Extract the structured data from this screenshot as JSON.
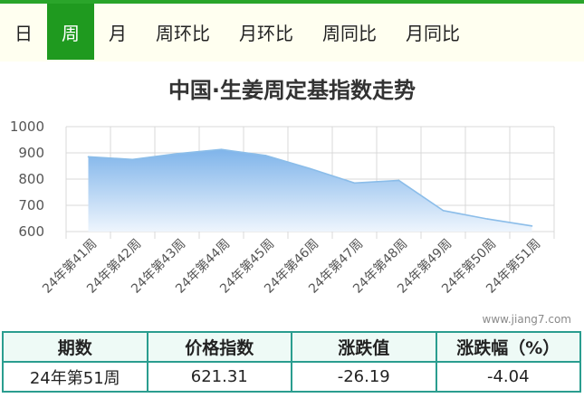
{
  "tabs": [
    {
      "label": "日",
      "active": false
    },
    {
      "label": "周",
      "active": true
    },
    {
      "label": "月",
      "active": false
    },
    {
      "label": "周环比",
      "active": false
    },
    {
      "label": "月环比",
      "active": false
    },
    {
      "label": "周同比",
      "active": false
    },
    {
      "label": "月同比",
      "active": false
    }
  ],
  "watermark": "www.jiang7.com",
  "table": {
    "headers": [
      "期数",
      "价格指数",
      "涨跌值",
      "涨跌幅（%）"
    ],
    "row": [
      "24年第51周",
      "621.31",
      "-26.19",
      "-4.04"
    ]
  },
  "colors": {
    "accent_green": "#1f9a1f",
    "area_top": "#7fb4ea",
    "area_bottom": "#eef5fd",
    "line": "#8bbde9",
    "table_border": "#2a9d8f",
    "table_header_bg": "#eefaf6"
  },
  "chart_data": {
    "type": "area",
    "title": "中国·生姜周定基指数走势",
    "categories": [
      "24年第41周",
      "24年第42周",
      "24年第43周",
      "24年第44周",
      "24年第45周",
      "24年第46周",
      "24年第47周",
      "24年第48周",
      "24年第49周",
      "24年第50周",
      "24年第51周"
    ],
    "series": [
      {
        "values": [
          885,
          875,
          897,
          913,
          890,
          840,
          785,
          795,
          680,
          648,
          621.31
        ]
      }
    ],
    "ylim": [
      600,
      1000
    ],
    "yticks": [
      600,
      700,
      800,
      900,
      1000
    ],
    "grid": true,
    "legend": "none"
  }
}
